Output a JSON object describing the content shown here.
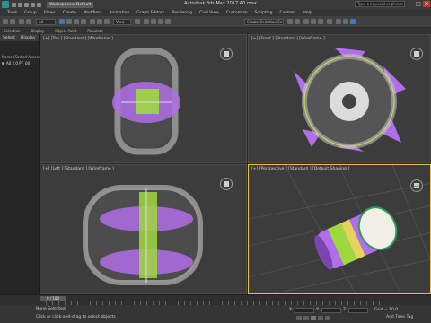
{
  "window": {
    "title": "Autodesk 3ds Max 2017     A0.max",
    "workspace": "Workspaces: Default",
    "search_placeholder": "Type a keyword or phrase"
  },
  "menu": [
    "Tools",
    "Group",
    "Views",
    "Create",
    "Modifiers",
    "Animation",
    "Graph Editors",
    "Rendering",
    "Civil View",
    "Customize",
    "Scripting",
    "Content",
    "Help"
  ],
  "toolbar": {
    "filter": "All",
    "view": "View",
    "selection_set": "Create Selection Se"
  },
  "ribbon": [
    "Selection",
    "Display",
    "Object Paint",
    "Populate"
  ],
  "scene_explorer": {
    "tabs": [
      "Select",
      "Display"
    ],
    "sort_label": "Name (Sorted Ascending)",
    "items": [
      "A0 2.0 PT_00"
    ]
  },
  "viewports": [
    {
      "label": "[+] [Top ] [Standard ] [Wireframe ]"
    },
    {
      "label": "[+] [Front ] [Standard ] [Wireframe ]"
    },
    {
      "label": "[+] [Left ] [Standard ] [Wireframe ]"
    },
    {
      "label": "[+] [Perspective ] [Standard ] [Default Shading ]"
    }
  ],
  "timeline": {
    "frame": "0 / 100"
  },
  "status": {
    "selection": "None Selected",
    "hint": "Click or click-and-drag to select objects",
    "x_label": "X:",
    "y_label": "Y:",
    "z_label": "Z:",
    "grid": "Grid = 10,0",
    "add_time_tag": "Add Time Tag"
  },
  "colors": {
    "purple": "#b06ee8",
    "lime": "#9ed83f",
    "wire": "#d8d8d8",
    "active_border": "#e6c34a"
  }
}
